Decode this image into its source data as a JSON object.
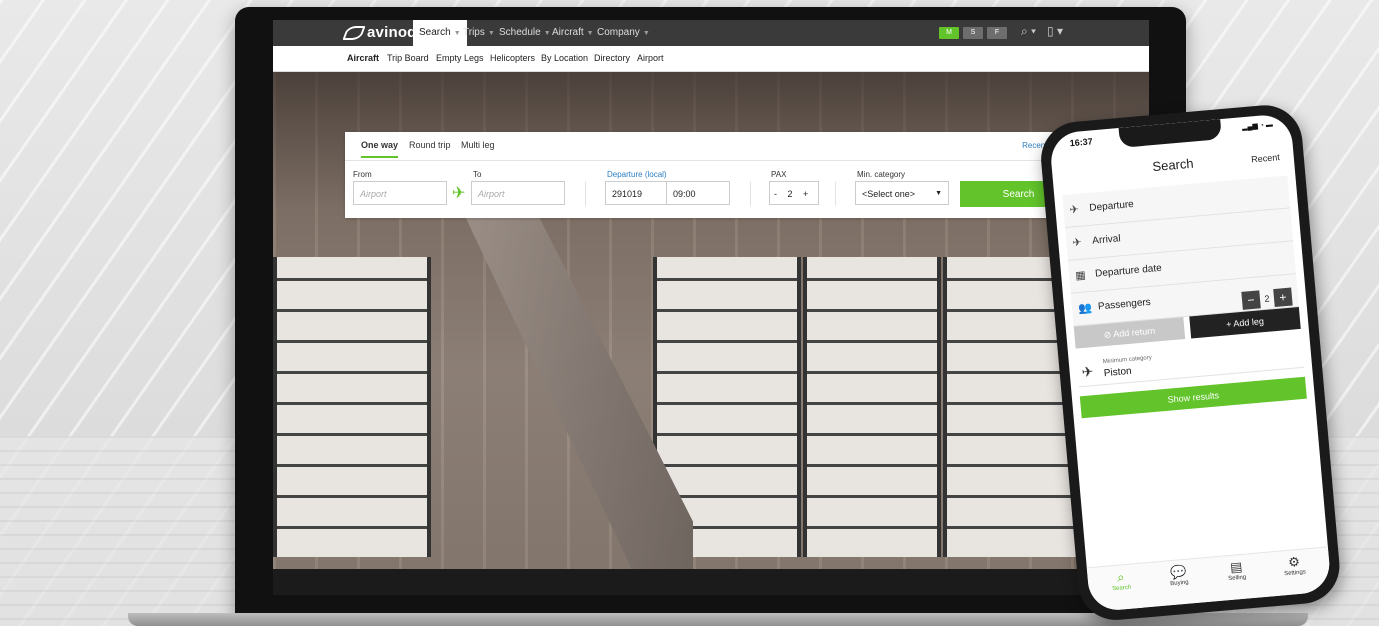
{
  "desktop": {
    "brand": "avinode",
    "nav": [
      {
        "label": "Search",
        "active": true
      },
      {
        "label": "Trips",
        "active": false
      },
      {
        "label": "Schedule",
        "active": false
      },
      {
        "label": "Aircraft",
        "active": false
      },
      {
        "label": "Company",
        "active": false
      }
    ],
    "pills": [
      "M",
      "S",
      "F"
    ],
    "subnav": [
      "Aircraft",
      "Trip Board",
      "Empty Legs",
      "Helicopters",
      "By Location",
      "Directory",
      "Airport"
    ],
    "tabs": [
      "One way",
      "Round trip",
      "Multi leg"
    ],
    "recent_trips": "Recent Trips",
    "from_label": "From",
    "to_label": "To",
    "airport_placeholder": "Airport",
    "departure_label": "Departure",
    "departure_local": "(local)",
    "date_value": "291019",
    "time_value": "09:00",
    "pax_label": "PAX",
    "pax_minus": "-",
    "pax_value": "2",
    "pax_plus": "+",
    "category_label": "Min. category",
    "category_value": "<Select one>",
    "search_button": "Search"
  },
  "mobile": {
    "time": "16:37",
    "title": "Search",
    "recent": "Recent",
    "rows": {
      "departure": "Departure",
      "arrival": "Arrival",
      "departure_date": "Departure date",
      "passengers": "Passengers"
    },
    "passengers_value": "2",
    "add_return": "⊘ Add return",
    "add_leg": "+ Add leg",
    "min_category_label": "Minimum category",
    "min_category_value": "Piston",
    "show_results": "Show results",
    "tabs": [
      "Search",
      "Buying",
      "Selling",
      "Settings"
    ]
  },
  "colors": {
    "accent": "#62c42a",
    "link": "#2d7fc1",
    "nav_bg": "#3a3a3a"
  }
}
